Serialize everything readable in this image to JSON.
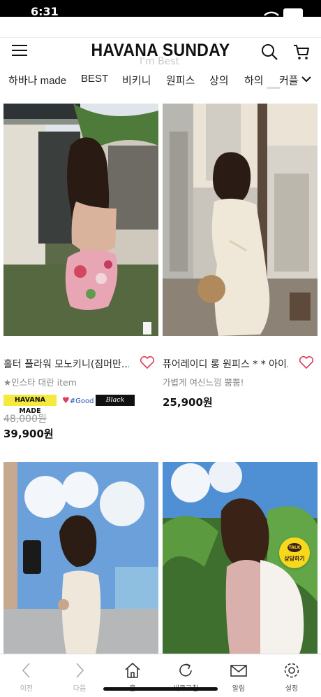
{
  "status": {
    "time": "6:31"
  },
  "header": {
    "logo": "HAVANA SUNDAY",
    "ghost_text": "I'm Best"
  },
  "categories": [
    "하바나 made",
    "BEST",
    "비키니",
    "원피스",
    "상의",
    "하의",
    "커플"
  ],
  "products": [
    {
      "name": "홀터 플라워 모노키니(짐머만...",
      "subtitle": "★인스타 대란 item",
      "badges": {
        "made": "HAVANA MADE",
        "good": "#Good",
        "black": "Black Label"
      },
      "old_price": "48,000원",
      "price": "39,900원"
    },
    {
      "name": "퓨어레이디 롱 원피스 * * 아이...",
      "subtitle": "가볍게 여신느낌 뿜뿜!",
      "price": "25,900원"
    },
    {
      "name": "",
      "price": ""
    },
    {
      "name": "",
      "price": ""
    }
  ],
  "talk": {
    "bubble": "TALK",
    "label": "상담하기"
  },
  "tabbar": [
    {
      "label": "이전",
      "icon": "chevron-left-icon"
    },
    {
      "label": "다음",
      "icon": "chevron-right-icon"
    },
    {
      "label": "홈",
      "icon": "home-icon"
    },
    {
      "label": "새로고침",
      "icon": "refresh-icon"
    },
    {
      "label": "알림",
      "icon": "mail-icon"
    },
    {
      "label": "설정",
      "icon": "gear-icon"
    }
  ],
  "colors": {
    "badge_yellow": "#f4e93c",
    "heart_red": "#e03c59",
    "kakao_yellow": "#f7d81c"
  }
}
